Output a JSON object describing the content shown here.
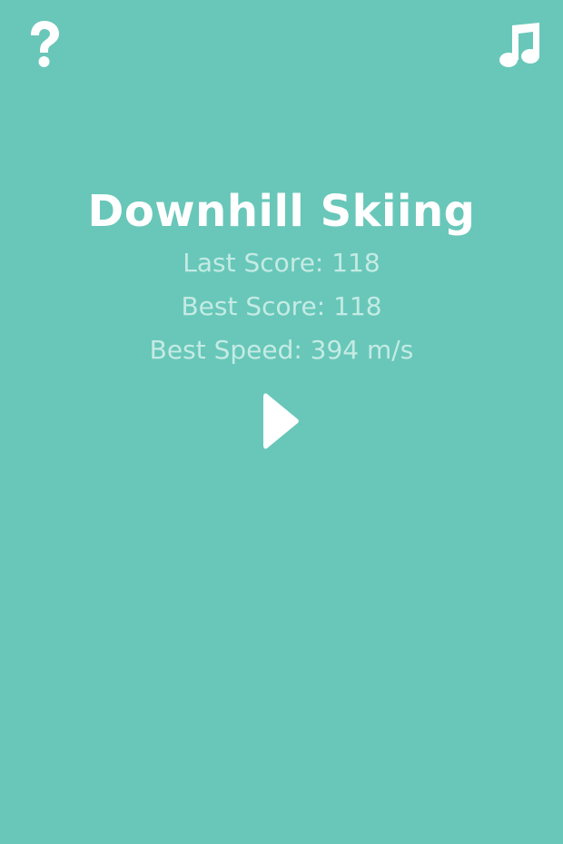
{
  "title": "Downhill Skiing",
  "stats": {
    "last_score": "Last Score: 118",
    "best_score": "Best Score: 118",
    "best_speed": "Best Speed: 394 m/s"
  },
  "icons": {
    "help": "question-mark-icon",
    "music": "music-note-icon",
    "play": "play-icon"
  },
  "colors": {
    "background": "#68c7b9",
    "title": "#ffffff",
    "stat_text": "#c4ebe4"
  }
}
